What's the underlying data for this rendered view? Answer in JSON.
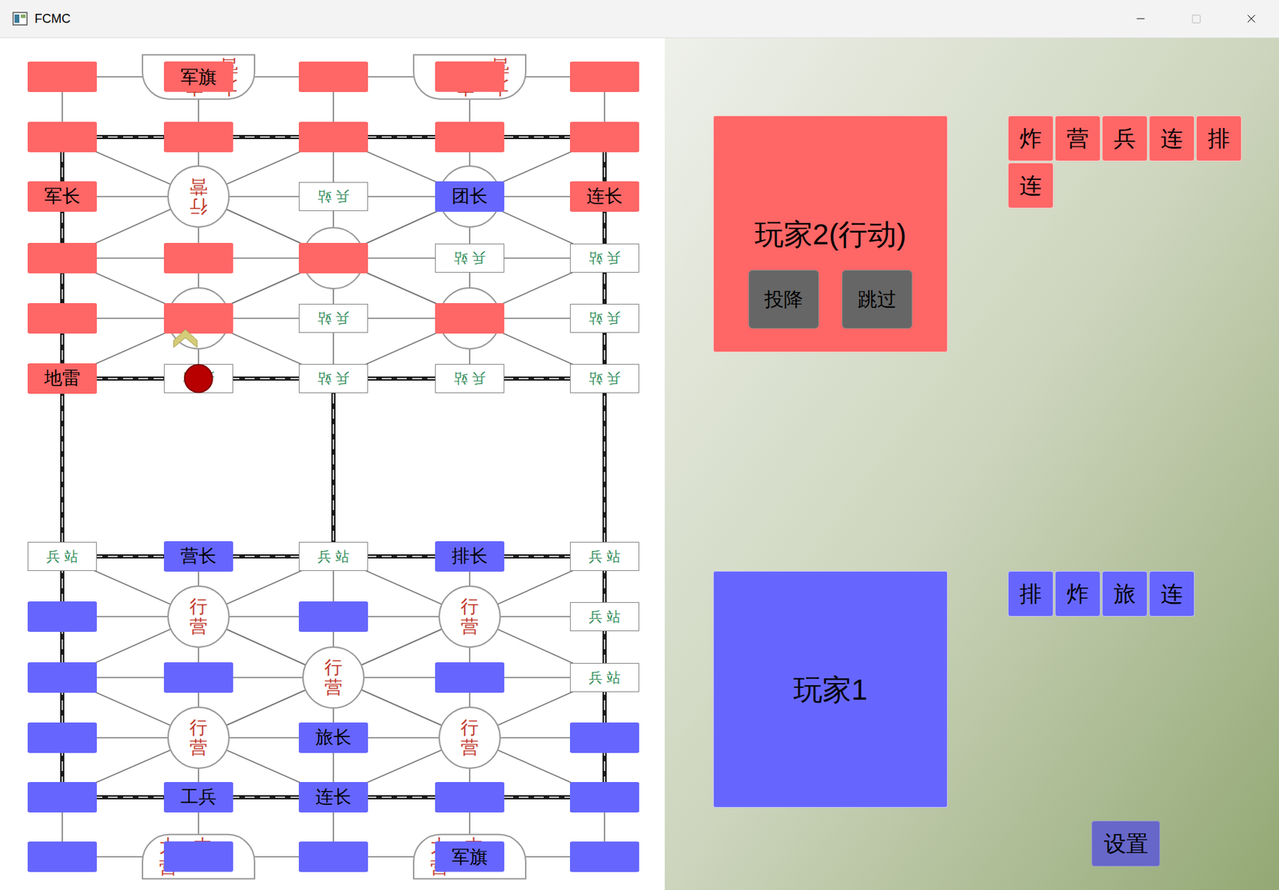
{
  "window": {
    "title": "FCMC"
  },
  "sides": {
    "red": "#ff6666",
    "blue": "#6666ff"
  },
  "cell_labels": {
    "station": "兵 站",
    "camp": "行营",
    "hq": "大本营"
  },
  "board": {
    "rows": [
      [
        {
          "type": "station",
          "piece": {
            "side": "red",
            "label": ""
          }
        },
        {
          "type": "hq",
          "piece": {
            "side": "red",
            "label": "军旗"
          }
        },
        {
          "type": "station",
          "piece": {
            "side": "red",
            "label": ""
          }
        },
        {
          "type": "hq",
          "piece": {
            "side": "red",
            "label": ""
          }
        },
        {
          "type": "station",
          "piece": {
            "side": "red",
            "label": ""
          }
        }
      ],
      [
        {
          "type": "station",
          "piece": {
            "side": "red",
            "label": ""
          }
        },
        {
          "type": "station",
          "piece": {
            "side": "red",
            "label": ""
          }
        },
        {
          "type": "station",
          "piece": {
            "side": "red",
            "label": ""
          }
        },
        {
          "type": "station",
          "piece": {
            "side": "red",
            "label": ""
          }
        },
        {
          "type": "station",
          "piece": {
            "side": "red",
            "label": ""
          }
        }
      ],
      [
        {
          "type": "station",
          "piece": {
            "side": "red",
            "label": "军长"
          }
        },
        {
          "type": "camp",
          "piece": null
        },
        {
          "type": "station",
          "piece": null
        },
        {
          "type": "camp",
          "piece": {
            "side": "blue",
            "label": "团长"
          }
        },
        {
          "type": "station",
          "piece": {
            "side": "red",
            "label": "连长"
          }
        }
      ],
      [
        {
          "type": "station",
          "piece": {
            "side": "red",
            "label": ""
          }
        },
        {
          "type": "station",
          "piece": {
            "side": "red",
            "label": ""
          }
        },
        {
          "type": "camp",
          "piece": {
            "side": "red",
            "label": ""
          }
        },
        {
          "type": "station",
          "piece": null
        },
        {
          "type": "station",
          "piece": null
        }
      ],
      [
        {
          "type": "station",
          "piece": {
            "side": "red",
            "label": ""
          }
        },
        {
          "type": "camp",
          "piece": {
            "side": "red",
            "label": ""
          }
        },
        {
          "type": "station",
          "piece": null
        },
        {
          "type": "camp",
          "piece": {
            "side": "red",
            "label": ""
          }
        },
        {
          "type": "station",
          "piece": null
        }
      ],
      [
        {
          "type": "station",
          "piece": {
            "side": "red",
            "label": "地雷"
          }
        },
        {
          "type": "station",
          "piece": null
        },
        {
          "type": "station",
          "piece": null
        },
        {
          "type": "station",
          "piece": null
        },
        {
          "type": "station",
          "piece": null
        }
      ],
      [
        {
          "type": "station",
          "piece": null
        },
        {
          "type": "station",
          "piece": {
            "side": "blue",
            "label": "营长"
          }
        },
        {
          "type": "station",
          "piece": null
        },
        {
          "type": "station",
          "piece": {
            "side": "blue",
            "label": "排长"
          }
        },
        {
          "type": "station",
          "piece": null
        }
      ],
      [
        {
          "type": "station",
          "piece": {
            "side": "blue",
            "label": ""
          }
        },
        {
          "type": "camp",
          "piece": null
        },
        {
          "type": "station",
          "piece": {
            "side": "blue",
            "label": ""
          }
        },
        {
          "type": "camp",
          "piece": null
        },
        {
          "type": "station",
          "piece": null
        }
      ],
      [
        {
          "type": "station",
          "piece": {
            "side": "blue",
            "label": ""
          }
        },
        {
          "type": "station",
          "piece": {
            "side": "blue",
            "label": ""
          }
        },
        {
          "type": "camp",
          "piece": null
        },
        {
          "type": "station",
          "piece": {
            "side": "blue",
            "label": ""
          }
        },
        {
          "type": "station",
          "piece": null
        }
      ],
      [
        {
          "type": "station",
          "piece": {
            "side": "blue",
            "label": ""
          }
        },
        {
          "type": "camp",
          "piece": null
        },
        {
          "type": "station",
          "piece": {
            "side": "blue",
            "label": "旅长"
          }
        },
        {
          "type": "camp",
          "piece": null
        },
        {
          "type": "station",
          "piece": {
            "side": "blue",
            "label": ""
          }
        }
      ],
      [
        {
          "type": "station",
          "piece": {
            "side": "blue",
            "label": ""
          }
        },
        {
          "type": "station",
          "piece": {
            "side": "blue",
            "label": "工兵"
          }
        },
        {
          "type": "station",
          "piece": {
            "side": "blue",
            "label": "连长"
          }
        },
        {
          "type": "station",
          "piece": {
            "side": "blue",
            "label": ""
          }
        },
        {
          "type": "station",
          "piece": {
            "side": "blue",
            "label": ""
          }
        }
      ],
      [
        {
          "type": "station",
          "piece": {
            "side": "blue",
            "label": ""
          }
        },
        {
          "type": "hq",
          "piece": {
            "side": "blue",
            "label": ""
          }
        },
        {
          "type": "station",
          "piece": {
            "side": "blue",
            "label": ""
          }
        },
        {
          "type": "hq",
          "piece": {
            "side": "blue",
            "label": "军旗"
          }
        },
        {
          "type": "station",
          "piece": {
            "side": "blue",
            "label": ""
          }
        }
      ]
    ]
  },
  "last_move": {
    "from": [
      5,
      1
    ],
    "to": [
      4,
      1
    ]
  },
  "players": [
    {
      "name": "玩家2(行动)",
      "side": "red",
      "active": true,
      "buttons": [
        "投降",
        "跳过"
      ],
      "captured": [
        "炸",
        "营",
        "兵",
        "连",
        "排",
        "连"
      ]
    },
    {
      "name": "玩家1",
      "side": "blue",
      "active": false,
      "buttons": [],
      "captured": [
        "排",
        "炸",
        "旅",
        "连"
      ]
    }
  ],
  "settings_button": "设置"
}
